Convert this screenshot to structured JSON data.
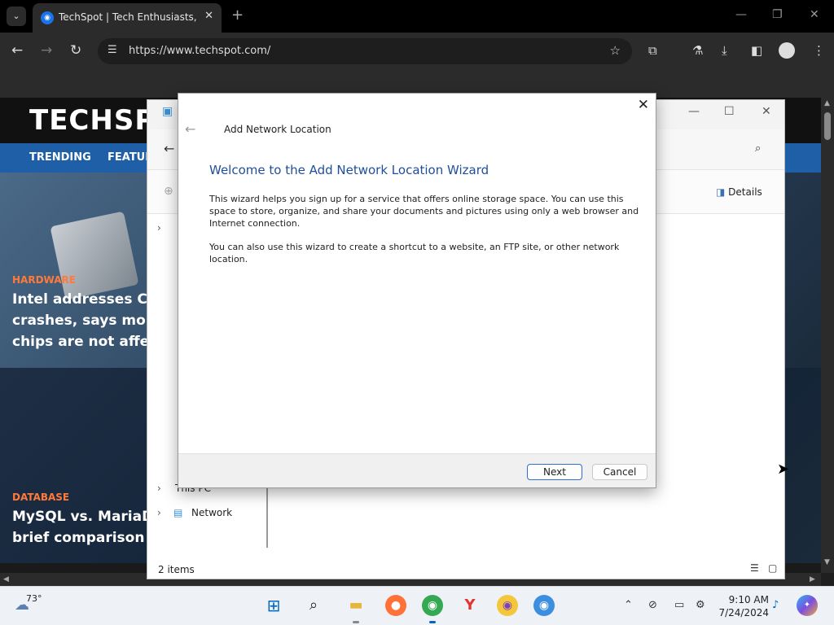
{
  "browser": {
    "tab_title": "TechSpot | Tech Enthusiasts, Power Users, Gamers",
    "url": "https://www.techspot.com/"
  },
  "site": {
    "logo": "TECHSPOT",
    "nav": [
      "TRENDING",
      "FEATURES"
    ],
    "articles": [
      {
        "category": "HARDWARE",
        "headline_lines": [
          "Intel addresses CPU",
          "crashes, says mobile",
          "chips are not affected"
        ]
      },
      {
        "category": "DATABASE",
        "headline_lines": [
          "MySQL vs. MariaDB: A",
          "brief comparison guide"
        ]
      }
    ]
  },
  "explorer": {
    "details_label": "Details",
    "nav_items": [
      "This PC",
      "Network"
    ],
    "status": "2 items"
  },
  "wizard": {
    "title": "Add Network Location",
    "heading": "Welcome to the Add Network Location Wizard",
    "paragraph1": "This wizard helps you sign up for a service that offers online storage space.  You can use this space to store, organize, and share your documents and pictures using only a web browser and Internet connection.",
    "paragraph2": "You can also use this wizard to create a shortcut to a website, an FTP site, or other network location.",
    "next_label": "Next",
    "cancel_label": "Cancel"
  },
  "taskbar": {
    "weather_temp": "73°",
    "time": "9:10 AM",
    "date": "7/24/2024"
  },
  "colors": {
    "wizard_heading": "#1f4e9a",
    "site_nav": "#1f5fa8",
    "category_accent": "#ff7a3a",
    "primary_button_border": "#2f6fd4"
  }
}
